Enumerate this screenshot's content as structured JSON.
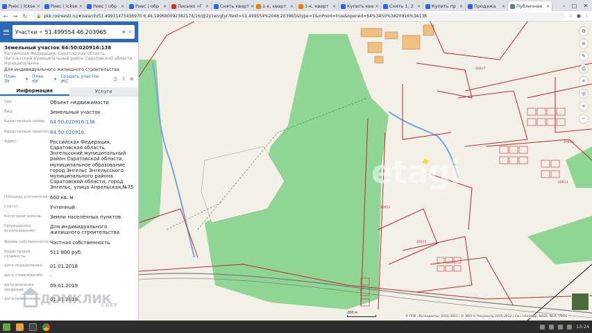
{
  "browser": {
    "tabs": [
      {
        "label": "Риес | Ickse",
        "icon": "blue"
      },
      {
        "label": "Риес | Ickse",
        "icon": "blue"
      },
      {
        "label": "Риес | обр",
        "icon": "blue"
      },
      {
        "label": "Риес | обр",
        "icon": "blue"
      },
      {
        "label": "Письмо «Г",
        "icon": "red"
      },
      {
        "label": "Снять кварт",
        "icon": "blue"
      },
      {
        "label": "1-к. кварт",
        "icon": "orange"
      },
      {
        "label": "1-к. кварт",
        "icon": "orange"
      },
      {
        "label": "Купить ква",
        "icon": "blue"
      },
      {
        "label": "Снять 1, 2",
        "icon": "blue"
      },
      {
        "label": "Купить пр",
        "icon": "blue"
      },
      {
        "label": "Продажа",
        "icon": "blue"
      },
      {
        "label": "Публичная",
        "icon": "gray"
      }
    ],
    "url": "pkk.rosreestr.ru/#/search/51.49931475436970 6,46.199680092382174/16/@2y1wvgtyr?text=51.499554%2046.203965&type=1&inPoint=true&opened=64%3A50%3A20916%3A138"
  },
  "panel": {
    "search_type": "Участки",
    "search_value": "51.499554 46.203965",
    "title": "Земельный участок 64:50:020916:138",
    "address_short": "Российская Федерация, Саратовская область, Энгельсский муниципальный район Саратовской области, муниципальное ...",
    "purpose": "Для индивидуального жилищного строительства",
    "links": [
      "План ЗУ",
      "План КК",
      "Создать участок ЖС"
    ],
    "tabs": {
      "info": "Информация",
      "services": "Услуги"
    },
    "props": [
      {
        "k": "Тип:",
        "v": "Объект недвижимости"
      },
      {
        "k": "Вид:",
        "v": "Земельный участок"
      },
      {
        "k": "Кадастровый номер:",
        "v": "64:50:020916:138",
        "link": true
      },
      {
        "k": "Кадастровый квартал:",
        "v": "64:50:020916",
        "link": true
      },
      {
        "k": "Адрес:",
        "v": "Российская Федерация, Саратовская область, Энгельсский муниципальный район Саратовской области, муниципальное образование город Энгельс Энгельсского муниципального района Саратовской области, город Энгельс, улица Апрельская,№75"
      },
      {
        "k": "Площадь уточненная:",
        "v": "600 кв. м"
      },
      {
        "k": "Статус:",
        "v": "Учтенный"
      },
      {
        "k": "Категория земель:",
        "v": "Земли населённых пунктов"
      },
      {
        "k": "Разрешенное использование:",
        "v": "Для индивидуального жилищного строительства"
      },
      {
        "k": "Форма собственности:",
        "v": "Частная собственность"
      },
      {
        "k": "Кадастровая стоимость:",
        "v": "511 800 руб."
      },
      {
        "k": "дата определения:",
        "v": "01.01.2018"
      },
      {
        "k": "дата утверждения:",
        "v": "-"
      },
      {
        "k": "дата внесения сведений:",
        "v": "09.01.2019"
      },
      {
        "k": "дата применения:",
        "v": "01.01.2019"
      }
    ]
  },
  "watermark": {
    "brand": "ДОМКЛИК",
    "sub": "СБЕР"
  },
  "map": {
    "watermark": "etagi",
    "scale_label": "200 м",
    "copyright": "© ППК «Роскадастр» 2010-2022 | © ЭКО © Росреестр 2010-2022 | Esri, Intermap, NASA, NGA, USGS",
    "labels": [
      "20917",
      "20912",
      "20913",
      "20916",
      "20914"
    ],
    "colors": {
      "green": "#8fd694",
      "boundary": "#c0272d",
      "water": "#6fa8dc"
    }
  },
  "taskbar": {
    "time": "13:24"
  }
}
